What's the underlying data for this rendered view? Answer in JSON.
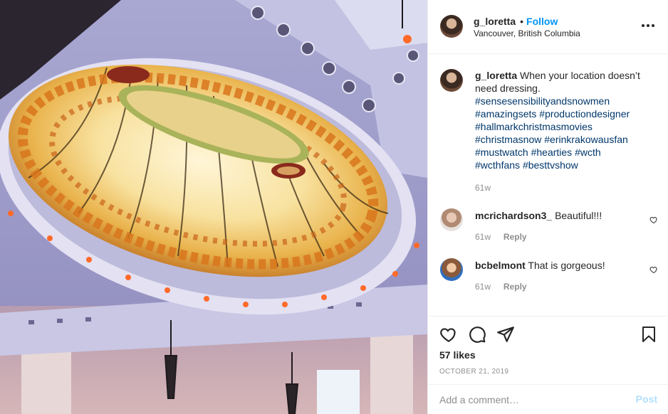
{
  "post": {
    "username": "g_loretta",
    "follow_label": "Follow",
    "location": "Vancouver, British Columbia",
    "image_alt": "Stained glass dome ceiling"
  },
  "caption": {
    "username": "g_loretta",
    "text": "When your location doesn’t need dressing.",
    "hashtags": [
      "#sensesensibilityandsnowmen",
      "#amazingsets",
      "#productiondesigner",
      "#hallmarkchristmasmovies",
      "#christmasnow",
      "#erinkrakowausfan",
      "#mustwatch",
      "#hearties",
      "#wcth",
      "#wcthfans",
      "#besttvshow"
    ],
    "time": "61w"
  },
  "comments": [
    {
      "username": "mcrichardson3_",
      "text": "Beautiful!!!",
      "time": "61w",
      "reply_label": "Reply"
    },
    {
      "username": "bcbelmont",
      "text": "That is gorgeous!",
      "time": "61w",
      "reply_label": "Reply"
    }
  ],
  "actions": {
    "likes": "57 likes",
    "date": "OCTOBER 21, 2019"
  },
  "comment_box": {
    "placeholder": "Add a comment…",
    "post_label": "Post"
  },
  "icons": {
    "like": "heart-icon",
    "comment": "comment-bubble-icon",
    "share": "paper-plane-icon",
    "save": "bookmark-icon",
    "more": "more-options-icon"
  },
  "colors": {
    "accent": "#0095f6",
    "hashtag": "#00376b",
    "muted": "#8e8e8e",
    "post_disabled": "#b2dffc"
  }
}
